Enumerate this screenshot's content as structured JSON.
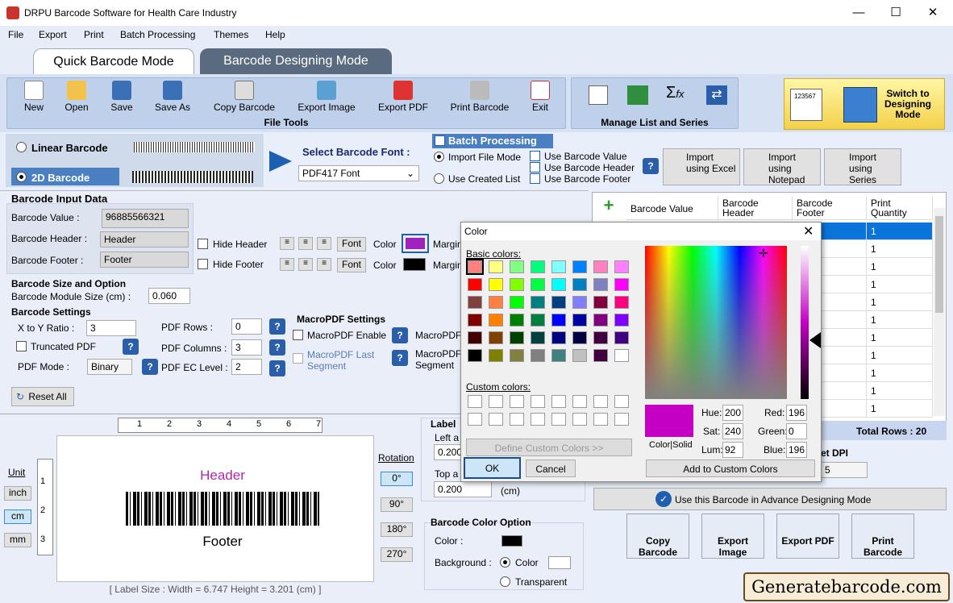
{
  "window": {
    "title": "DRPU Barcode Software for Health Care Industry"
  },
  "menu": [
    "File",
    "Export",
    "Print",
    "Batch Processing",
    "Themes",
    "Help"
  ],
  "tabs": {
    "quick": "Quick Barcode Mode",
    "designing": "Barcode Designing Mode"
  },
  "file_tools": {
    "label": "File Tools",
    "buttons": [
      "New",
      "Open",
      "Save",
      "Save As",
      "Copy Barcode",
      "Export Image",
      "Export PDF",
      "Print Barcode",
      "Exit"
    ]
  },
  "manage": {
    "label": "Manage List and Series"
  },
  "switch_btn": {
    "label": "Switch to Designing Mode",
    "sample": "123567"
  },
  "barcode_type": {
    "linear": "Linear Barcode",
    "twod": "2D Barcode",
    "select_font_label": "Select Barcode Font :",
    "font_value": "PDF417 Font"
  },
  "batch": {
    "title": "Batch Processing",
    "import_file_mode": "Import File Mode",
    "use_created_list": "Use Created List",
    "use_value": "Use Barcode Value",
    "use_header": "Use Barcode Header",
    "use_footer": "Use Barcode Footer",
    "import_excel": "Import using Excel",
    "import_notepad": "Import using Notepad",
    "import_series": "Import using Series"
  },
  "input": {
    "title": "Barcode Input Data",
    "value_label": "Barcode Value :",
    "value": "96885566321",
    "header_label": "Barcode Header :",
    "header": "Header",
    "footer_label": "Barcode Footer :",
    "footer": "Footer",
    "hide_header": "Hide Header",
    "hide_footer": "Hide Footer",
    "font": "Font",
    "color": "Color",
    "margin": "Margin"
  },
  "size": {
    "title": "Barcode Size and Option",
    "module_label": "Barcode Module Size (cm) :",
    "module": "0.060"
  },
  "settings": {
    "title": "Barcode Settings",
    "xy_label": "X to Y Ratio :",
    "xy": "3",
    "truncated": "Truncated PDF",
    "mode_label": "PDF Mode :",
    "mode": "Binary",
    "rows_label": "PDF Rows :",
    "rows": "0",
    "cols_label": "PDF Columns :",
    "cols": "3",
    "ec_label": "PDF EC Level :",
    "ec": "2",
    "macro_title": "MacroPDF Settings",
    "macro_enable": "MacroPDF Enable",
    "macro_last": "MacroPDF Last Segment",
    "macro_short": "MacroPDF",
    "macro_seg": "MacroPDF Segment",
    "reset": "Reset All"
  },
  "preview": {
    "unit": "Unit",
    "inch": "inch",
    "cm": "cm",
    "mm": "mm",
    "header": "Header",
    "footer": "Footer",
    "ruler": [
      "1",
      "2",
      "3",
      "4",
      "5",
      "6",
      "7"
    ],
    "vruler": [
      "1",
      "2",
      "3"
    ],
    "rotation": "Rotation",
    "rot": [
      "0°",
      "90°",
      "180°",
      "270°"
    ],
    "status": "[ Label Size : Width = 6.747  Height = 3.201 (cm) ]"
  },
  "label_panel": {
    "title": "Label",
    "left": "Left a",
    "left_val": "0.200",
    "top": "Top a",
    "top_val": "0.200",
    "cm": "(cm)",
    "color_title": "Barcode Color Option",
    "color": "Color :",
    "bg": "Background :",
    "bg_color": "Color",
    "transparent": "Transparent"
  },
  "table": {
    "cols": [
      "Barcode Value",
      "Barcode Header",
      "Barcode Footer",
      "Print Quantity"
    ],
    "row_prefix": "er",
    "qty": "1",
    "total": "Total Rows : 20",
    "dpi": "et DPI",
    "dpi_val": "5"
  },
  "advance": {
    "label": "Use this Barcode in Advance Designing Mode"
  },
  "bottom_buttons": [
    "Copy Barcode",
    "Export Image",
    "Export PDF",
    "Print Barcode"
  ],
  "watermark": "Generatebarcode.com",
  "dialog": {
    "title": "Color",
    "basic": "Basic colors:",
    "custom": "Custom colors:",
    "define": "Define Custom Colors >>",
    "ok": "OK",
    "cancel": "Cancel",
    "hue_l": "Hue:",
    "hue": "200",
    "sat_l": "Sat:",
    "sat": "240",
    "lum_l": "Lum:",
    "lum": "92",
    "red_l": "Red:",
    "red": "196",
    "green_l": "Green:",
    "green": "0",
    "blue_l": "Blue:",
    "blue": "196",
    "solid": "Color|Solid",
    "add": "Add to Custom Colors",
    "basic_colors": [
      "#ff8080",
      "#ffff80",
      "#80ff80",
      "#00ff80",
      "#80ffff",
      "#0080ff",
      "#ff80c0",
      "#ff80ff",
      "#ff0000",
      "#ffff00",
      "#80ff00",
      "#00ff40",
      "#00ffff",
      "#0080c0",
      "#8080c0",
      "#ff00ff",
      "#804040",
      "#ff8040",
      "#00ff00",
      "#008080",
      "#004080",
      "#8080ff",
      "#800040",
      "#ff0080",
      "#800000",
      "#ff8000",
      "#008000",
      "#008040",
      "#0000ff",
      "#0000a0",
      "#800080",
      "#8000ff",
      "#400000",
      "#804000",
      "#004000",
      "#004040",
      "#000080",
      "#000040",
      "#400040",
      "#400080",
      "#000000",
      "#808000",
      "#808040",
      "#808080",
      "#408080",
      "#c0c0c0",
      "#400040",
      "#ffffff"
    ],
    "picked": "#c400c4"
  }
}
